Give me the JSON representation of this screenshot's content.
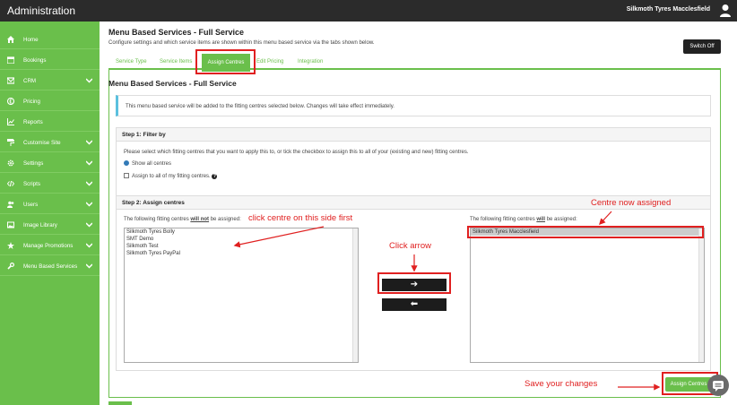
{
  "app": {
    "title": "Administration",
    "user_name": "Silkmoth Tyres Macclesfield"
  },
  "sidebar": {
    "items": [
      {
        "label": "Home",
        "icon": "home-icon",
        "has_chevron": false
      },
      {
        "label": "Bookings",
        "icon": "calendar-icon",
        "has_chevron": false
      },
      {
        "label": "CRM",
        "icon": "envelope-icon",
        "has_chevron": true
      },
      {
        "label": "Pricing",
        "icon": "pound-icon",
        "has_chevron": false
      },
      {
        "label": "Reports",
        "icon": "chart-icon",
        "has_chevron": false
      },
      {
        "label": "Customise Site",
        "icon": "paint-roller-icon",
        "has_chevron": true
      },
      {
        "label": "Settings",
        "icon": "gear-icon",
        "has_chevron": true
      },
      {
        "label": "Scripts",
        "icon": "code-icon",
        "has_chevron": true
      },
      {
        "label": "Users",
        "icon": "users-icon",
        "has_chevron": true
      },
      {
        "label": "Image Library",
        "icon": "image-icon",
        "has_chevron": true
      },
      {
        "label": "Manage Promotions",
        "icon": "star-icon",
        "has_chevron": true
      },
      {
        "label": "Menu Based Services",
        "icon": "wrench-icon",
        "has_chevron": true
      }
    ]
  },
  "page": {
    "title": "Menu Based Services - Full Service",
    "description": "Configure settings and which service items are shown within this menu based service via the tabs shown below.",
    "switch_label": "Switch Off"
  },
  "tabs": [
    "Service Type",
    "Service Items",
    "Assign Centres",
    "Edit Pricing",
    "Integration"
  ],
  "active_tab": "Assign Centres",
  "panel": {
    "title": "Menu Based Services - Full Service",
    "info": "This menu based service will be added to the fitting centres selected below. Changes will take effect immediately."
  },
  "filter": {
    "heading": "Step 1: Filter by",
    "description": "Please select which fitting centres that you want to apply this to, or tick the checkbox to assign this to all of your (existing and new) fitting centres.",
    "radio_label": "Show all centres",
    "checkbox_label": "Assign to all of my fitting centres.",
    "help_glyph": "?"
  },
  "assign": {
    "heading": "Step 2: Assign centres",
    "left_label_pre": "The following fitting centres ",
    "left_label_em": "will not",
    "left_label_post": " be assigned:",
    "right_label_pre": "The following fitting centres ",
    "right_label_em": "will",
    "right_label_post": " be assigned:",
    "unassigned": [
      "Silkmoth Tyres Bolly",
      "SMT Demo",
      "Silkmoth Test",
      "Silkmoth Tyres PayPal"
    ],
    "assigned": [
      "Silkmoth Tyres Macclesfield"
    ],
    "move_right_glyph": "➔",
    "move_left_glyph": "⬅"
  },
  "assign_button_label": "Assign Centres",
  "annotations": {
    "click_centre": "click centre on this side first",
    "click_arrow": "Click arrow",
    "centre_assigned": "Centre now assigned",
    "save_changes": "Save your changes"
  },
  "colors": {
    "brand_green": "#6abf4b",
    "topbar": "#2b2b2b",
    "annotation_red": "#e02020",
    "info_blue": "#5bc0de"
  }
}
